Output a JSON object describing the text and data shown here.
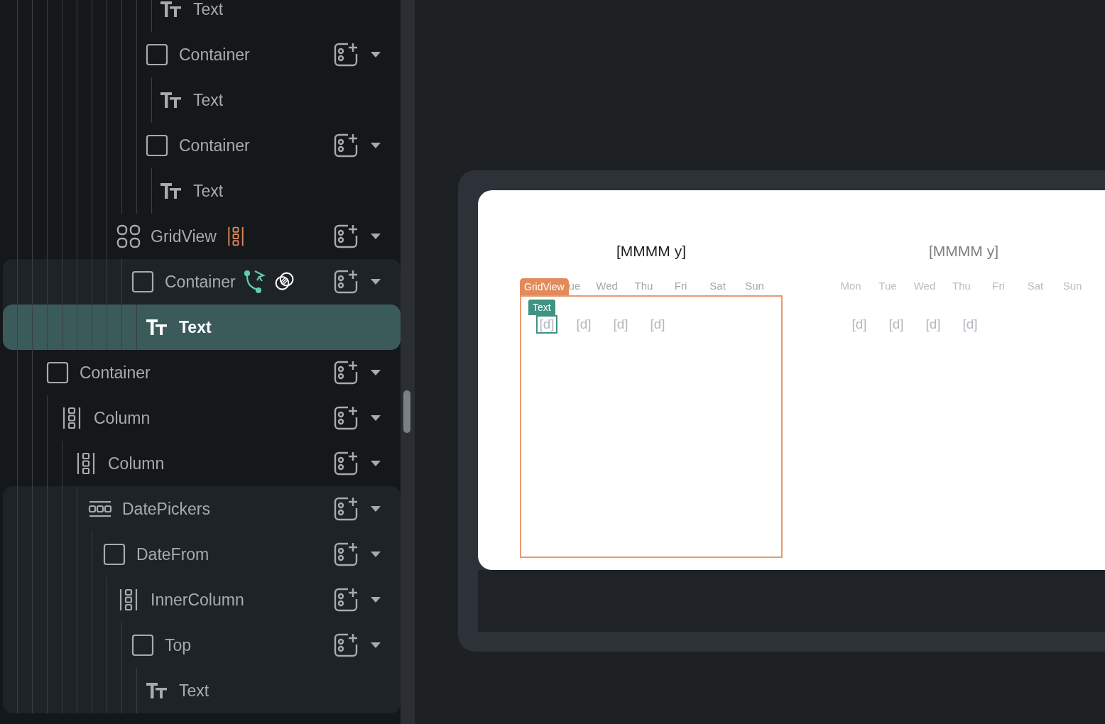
{
  "tree": [
    {
      "children": [
        {
          "children": [
            {
              "children": [
                {
                  "children": [
                    {
                      "children": [
                        {
                          "children": [
                            {
                              "children": [
                                {
                                  "children": [
                                    {
                                      "label": "Text",
                                      "kind": "text",
                                      "selected": false,
                                      "highlighted": false
                                    }
                                  ]
                                },
                                {
                                  "label": "Container",
                                  "kind": "container",
                                  "selected": false,
                                  "highlighted": false,
                                  "children": [
                                    {
                                      "label": "Text",
                                      "kind": "text",
                                      "selected": false,
                                      "highlighted": false
                                    }
                                  ]
                                },
                                {
                                  "label": "Container",
                                  "kind": "container",
                                  "selected": false,
                                  "highlighted": false,
                                  "children": [
                                    {
                                      "label": "Text",
                                      "kind": "text",
                                      "selected": false,
                                      "highlighted": false
                                    }
                                  ]
                                }
                              ]
                            }
                          ]
                        },
                        {
                          "label": "GridView",
                          "kind": "grid",
                          "selected": false,
                          "highlighted": false,
                          "badges": [
                            {
                              "kind": "column"
                            }
                          ],
                          "children": [
                            {
                              "label": "Container",
                              "kind": "container",
                              "selected": false,
                              "highlighted": true,
                              "badges": [
                                {
                                  "kind": "logic"
                                },
                                {
                                  "kind": "overlap"
                                }
                              ],
                              "children": [
                                {
                                  "label": "Text",
                                  "kind": "text",
                                  "selected": true,
                                  "highlighted": false
                                }
                              ]
                            }
                          ]
                        }
                      ]
                    }
                  ]
                }
              ]
            }
          ]
        }
      ]
    },
    {
      "label": "Container",
      "kind": "container",
      "selected": false,
      "highlighted": false,
      "children": [
        {
          "label": "Column",
          "kind": "column",
          "selected": false,
          "highlighted": false,
          "children": [
            {
              "label": "Column",
              "kind": "column",
              "selected": false,
              "highlighted": false,
              "children": [
                {
                  "label": "DatePickers",
                  "kind": "datepickers",
                  "selected": false,
                  "highlighted": true,
                  "children": [
                    {
                      "label": "DateFrom",
                      "kind": "container",
                      "selected": false,
                      "highlighted": false,
                      "children": [
                        {
                          "label": "InnerColumn",
                          "kind": "column",
                          "selected": false,
                          "highlighted": false,
                          "children": [
                            {
                              "label": "Top",
                              "kind": "container",
                              "selected": false,
                              "highlighted": false,
                              "children": [
                                {
                                  "label": "Text",
                                  "kind": "text",
                                  "selected": false,
                                  "highlighted": false
                                }
                              ]
                            }
                          ]
                        }
                      ]
                    }
                  ]
                }
              ]
            }
          ]
        }
      ]
    }
  ],
  "canvas": {
    "calendars": [
      {
        "title": "[MMMM y]",
        "dimmed": false,
        "grid_tag": "GridView",
        "weekdays": [
          "ue",
          "Wed",
          "Thu",
          "Fri",
          "Sat",
          "Sun"
        ],
        "days": [
          {
            "text": "[d]",
            "selected": true,
            "tag": "Text"
          },
          {
            "text": "[d]",
            "selected": false
          },
          {
            "text": "[d]",
            "selected": false
          },
          {
            "text": "[d]",
            "selected": false
          }
        ]
      },
      {
        "title": "[MMMM y]",
        "dimmed": true,
        "weekdays": [
          "Mon",
          "Tue",
          "Wed",
          "Thu",
          "Fri",
          "Sat",
          "Sun"
        ],
        "days": [
          {
            "text": "[d]",
            "selected": false
          },
          {
            "text": "[d]",
            "selected": false
          },
          {
            "text": "[d]",
            "selected": false
          },
          {
            "text": "[d]",
            "selected": false
          }
        ]
      }
    ]
  }
}
